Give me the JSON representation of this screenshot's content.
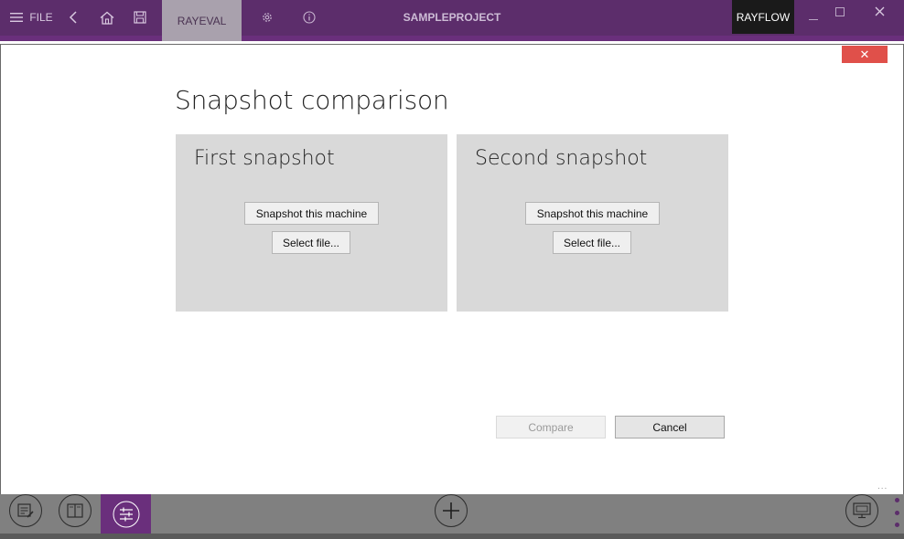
{
  "topbar": {
    "file_label": "FILE",
    "tab_label": "RAYEVAL",
    "project_name": "SAMPLEPROJECT",
    "right_tab_label": "RAYFLOW",
    "icons": [
      "menu-icon",
      "back-icon",
      "home-icon",
      "save-icon",
      "gear-icon",
      "info-icon",
      "minimize-icon",
      "maximize-icon",
      "close-icon"
    ]
  },
  "dialog": {
    "title": "Snapshot comparison",
    "close_glyph": "✕",
    "panels": [
      {
        "title": "First snapshot",
        "snapshot_button": "Snapshot this machine",
        "select_button": "Select file..."
      },
      {
        "title": "Second snapshot",
        "snapshot_button": "Snapshot this machine",
        "select_button": "Select file..."
      }
    ],
    "compare_button": "Compare",
    "cancel_button": "Cancel",
    "more_glyph": "..."
  },
  "bottombar": {
    "icons": [
      "edit-icon",
      "book-icon",
      "compare-icon",
      "add-icon",
      "monitor-icon",
      "more-vert-icon"
    ]
  },
  "colors": {
    "topbar_bg": "#5c2d6b",
    "accent_purple": "#6a2f7c",
    "close_red": "#e0504a",
    "panel_gray": "#d9d9d9"
  }
}
